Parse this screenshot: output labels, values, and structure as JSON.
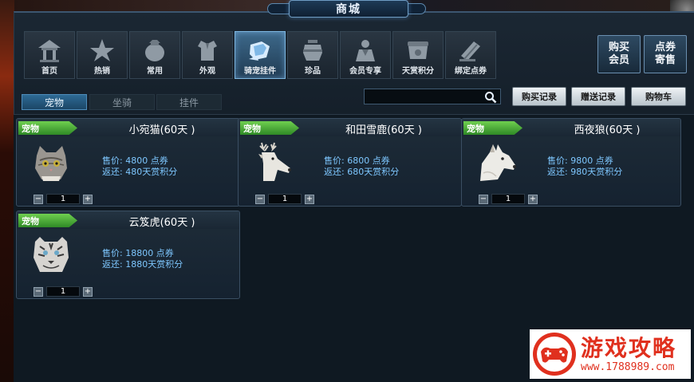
{
  "window": {
    "title": "商城"
  },
  "categories": [
    {
      "label": "首页",
      "icon": "home-icon",
      "active": false
    },
    {
      "label": "热销",
      "icon": "star-icon",
      "active": false
    },
    {
      "label": "常用",
      "icon": "bag-icon",
      "active": false
    },
    {
      "label": "外观",
      "icon": "armor-icon",
      "active": false
    },
    {
      "label": "骑宠挂件",
      "icon": "pet-mount-icon",
      "active": true
    },
    {
      "label": "珍品",
      "icon": "treasure-icon",
      "active": false
    },
    {
      "label": "会员专享",
      "icon": "member-icon",
      "active": false
    },
    {
      "label": "天赏积分",
      "icon": "points-icon",
      "active": false
    },
    {
      "label": "绑定点券",
      "icon": "bound-coupon-icon",
      "active": false
    }
  ],
  "side_buttons": {
    "buy_vip": "购买\n会员",
    "coupon_consign": "点券\n寄售"
  },
  "subtabs": [
    {
      "label": "宠物",
      "active": true
    },
    {
      "label": "坐骑",
      "active": false
    },
    {
      "label": "挂件",
      "active": false
    }
  ],
  "search": {
    "value": "",
    "placeholder": ""
  },
  "actions": {
    "purchase_history": "购买记录",
    "gift_history": "赠送记录",
    "cart": "购物车"
  },
  "items": [
    {
      "badge": "宠物",
      "name": "小宛猫(60天 )",
      "price": "售价: 4800 点券",
      "rebate": "返还: 480天赏积分",
      "qty": "1",
      "animal": "cat"
    },
    {
      "badge": "宠物",
      "name": "和田雪鹿(60天 )",
      "price": "售价: 6800 点券",
      "rebate": "返还: 680天赏积分",
      "qty": "1",
      "animal": "deer"
    },
    {
      "badge": "宠物",
      "name": "西夜狼(60天 )",
      "price": "售价: 9800 点券",
      "rebate": "返还: 980天赏积分",
      "qty": "1",
      "animal": "wolf"
    },
    {
      "badge": "宠物",
      "name": "云笈虎(60天 )",
      "price": "售价: 18800 点券",
      "rebate": "返还: 1880天赏积分",
      "qty": "1",
      "animal": "tiger"
    }
  ],
  "qty_controls": {
    "minus": "−",
    "plus": "+"
  },
  "watermark": {
    "title": "游戏攻略",
    "url": "www.1788989.com"
  },
  "colors": {
    "accent": "#3e6a8c",
    "badge_green": "#4fb03a",
    "price_blue": "#7ec7ff",
    "watermark_red": "#e0301e"
  }
}
